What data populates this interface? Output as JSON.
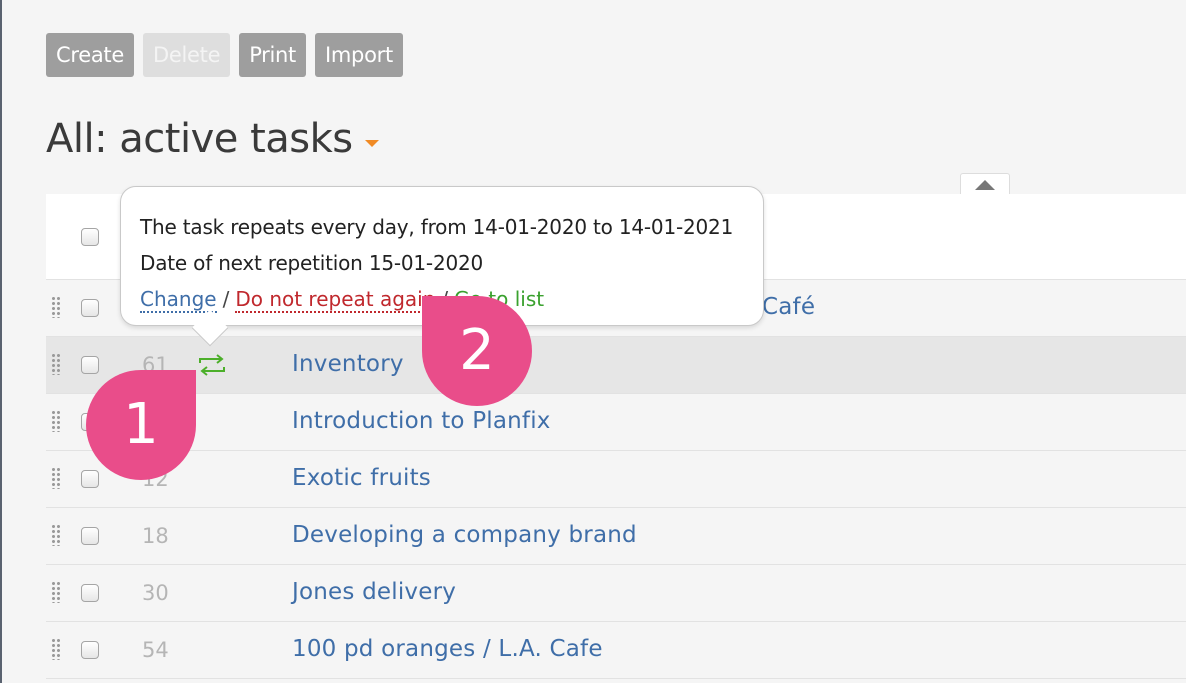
{
  "toolbar": {
    "create": "Create",
    "delete": "Delete",
    "print": "Print",
    "import": "Import"
  },
  "page_title": "All: active tasks",
  "tooltip": {
    "line1": "The task repeats every day, from 14-01-2020 to 14-01-2021",
    "line2": "Date of next repetition 15-01-2020",
    "link_change": "Change",
    "separator": "/",
    "link_no_repeat": "Do not repeat again",
    "link_go_list": "Go to list"
  },
  "rows": [
    {
      "num": "",
      "title": "Café"
    },
    {
      "num": "61",
      "title": "Inventory",
      "repeat": true
    },
    {
      "num": "",
      "title": "Introduction to Planfix"
    },
    {
      "num": "12",
      "title": "Exotic fruits"
    },
    {
      "num": "18",
      "title": "Developing a company brand"
    },
    {
      "num": "30",
      "title": "Jones delivery"
    },
    {
      "num": "54",
      "title": "100 pd oranges / L.A. Cafe"
    }
  ],
  "badges": {
    "one": "1",
    "two": "2"
  },
  "colors": {
    "link": "#3f6ea8",
    "danger_link": "#c0282d",
    "success_link": "#3aa12e",
    "badge": "#e94d8a",
    "accent_caret": "#f08a24",
    "repeat_icon": "#4caf2a"
  }
}
